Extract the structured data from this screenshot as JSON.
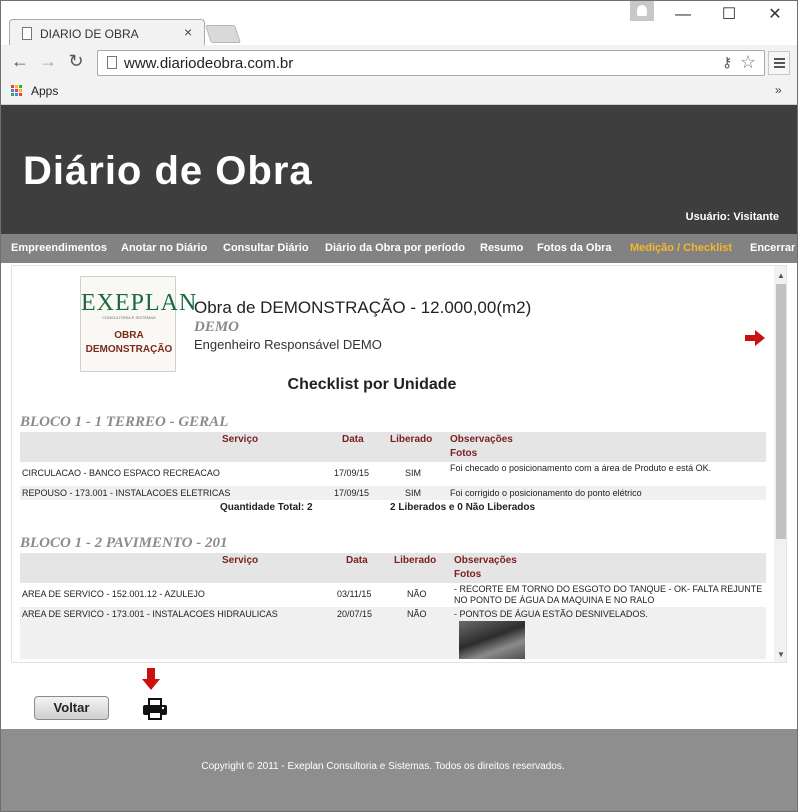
{
  "browser": {
    "tab_title": "DIARIO DE OBRA",
    "tab_close": "×",
    "url": "www.diariodeobra.com.br",
    "bookmarks_apps": "Apps",
    "bookmarks_more": "»",
    "win_minimize": "—",
    "win_maximize": "☐",
    "win_close": "✕",
    "nav_back": "←",
    "nav_forward": "→",
    "nav_reload": "↻"
  },
  "header": {
    "site_title": "Diário de Obra",
    "user_label": "Usuário: Visitante"
  },
  "nav": {
    "items": [
      "Empreendimentos",
      "Anotar no Diário",
      "Consultar Diário",
      "Diário da Obra por período",
      "Resumo",
      "Fotos da Obra",
      "Medição / Checklist",
      "Encerrar"
    ],
    "active_index": 6,
    "active_color": "#f7b52c"
  },
  "obra": {
    "logo_brand": "EXEPLAN",
    "logo_tagline": "CONSULTORIA E SISTEMAS",
    "logo_line1": "OBRA",
    "logo_line2": "DEMONSTRAÇÃO",
    "title": "Obra de DEMONSTRAÇÃO - 12.000,00(m2)",
    "code": "DEMO",
    "engineer": "Engenheiro Responsável DEMO"
  },
  "checklist": {
    "title": "Checklist por Unidade",
    "headers": {
      "servico": "Serviço",
      "data": "Data",
      "liberado": "Liberado",
      "observacoes": "Observações",
      "fotos": "Fotos"
    },
    "blocks": [
      {
        "title": "BLOCO 1 - 1 TERREO - GERAL",
        "rows": [
          {
            "servico": "CIRCULACAO - BANCO ESPACO RECREACAO",
            "data": "17/09/15",
            "liberado": "SIM",
            "obs": "Foi checado o posicionamento com a área de Produto e está OK."
          },
          {
            "servico": "REPOUSO - 173.001 - INSTALACOES ELETRICAS",
            "data": "17/09/15",
            "liberado": "SIM",
            "obs": "Foi corrigido o posicionamento do ponto elétrico"
          }
        ],
        "total": "Quantidade Total: 2",
        "summary": "2 Liberados e 0 Não Liberados"
      },
      {
        "title": "BLOCO 1 - 2 PAVIMENTO - 201",
        "rows": [
          {
            "servico": "AREA DE SERVICO - 152.001.12 - AZULEJO",
            "data": "03/11/15",
            "liberado": "NÃO",
            "obs": "- RECORTE EM TORNO DO ESGOTO DO TANQUE - OK- FALTA REJUNTE NO PONTO DE ÁGUA DA MAQUINA E NO RALO"
          },
          {
            "servico": "AREA DE SERVICO - 173.001 - INSTALACOES HIDRAULICAS",
            "data": "20/07/15",
            "liberado": "NÃO",
            "obs": "- PONTOS DE ÁGUA ESTÃO DESNIVELADOS."
          }
        ]
      }
    ]
  },
  "actions": {
    "voltar": "Voltar"
  },
  "footer": {
    "text": "Copyright © 2011 - Exeplan Consultoria e Sistemas. Todos os direitos reservados."
  },
  "colors": {
    "header_bg": "#3e3e3e",
    "nav_bg": "#828282",
    "footer_bg": "#8e8e8e",
    "arrow_red": "#cc1010",
    "header_text_red": "#7a1f1f"
  }
}
